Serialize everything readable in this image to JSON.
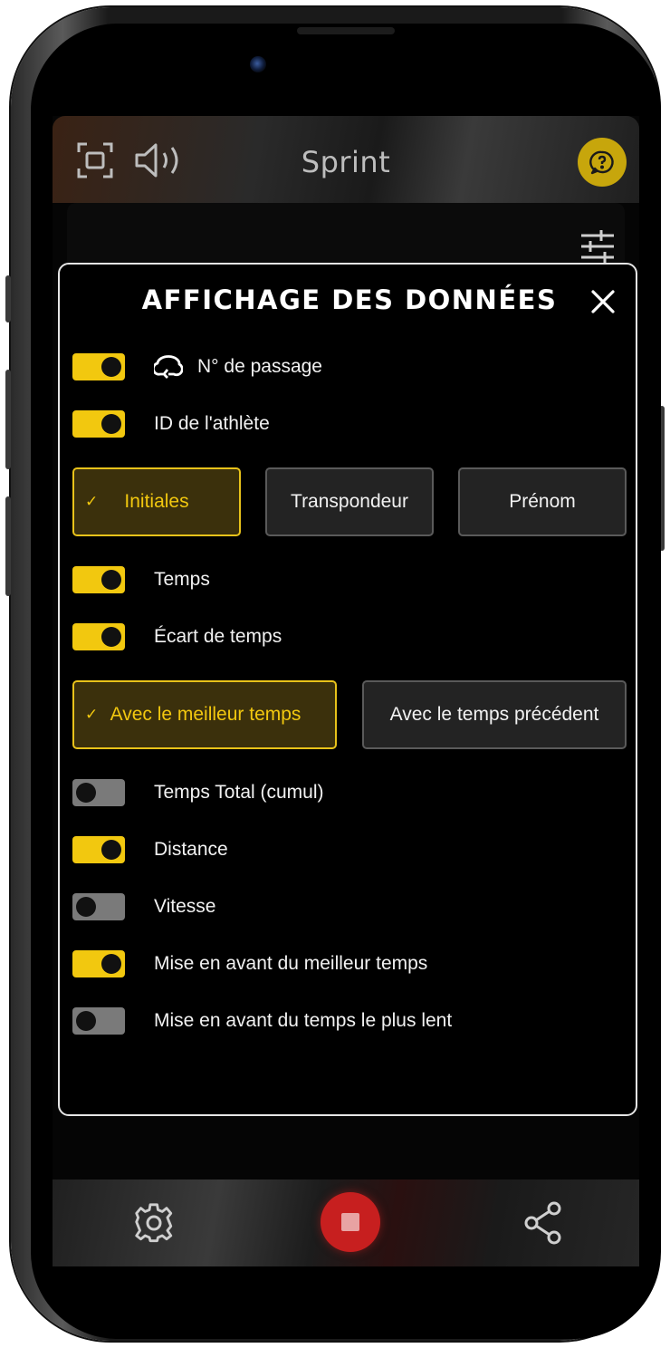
{
  "app": {
    "title": "Sprint"
  },
  "modal": {
    "title": "AFFICHAGE DES DONNÉES",
    "rows": [
      {
        "label": "N° de passage",
        "on": true
      },
      {
        "label": "ID de l'athlète",
        "on": true
      },
      {
        "label": "Temps",
        "on": true
      },
      {
        "label": "Écart de temps",
        "on": true
      },
      {
        "label": "Temps Total (cumul)",
        "on": false
      },
      {
        "label": "Distance",
        "on": true
      },
      {
        "label": "Vitesse",
        "on": false
      },
      {
        "label": "Mise en avant du meilleur temps",
        "on": true
      },
      {
        "label": "Mise en avant du temps le plus lent",
        "on": false
      }
    ],
    "athlete_id_options": [
      {
        "label": "Initiales",
        "selected": true
      },
      {
        "label": "Transpondeur",
        "selected": false
      },
      {
        "label": "Prénom",
        "selected": false
      }
    ],
    "gap_options": [
      {
        "label": "Avec le meilleur temps",
        "selected": true
      },
      {
        "label": "Avec le temps précédent",
        "selected": false
      }
    ],
    "check_glyph": "✓"
  },
  "icons": {
    "topbar": [
      "fullscreen-icon",
      "speaker-icon",
      "help-chat-icon"
    ],
    "card": [
      "filter-sliders-icon"
    ],
    "modal": [
      "close-icon",
      "loop-icon"
    ],
    "bottombar": [
      "settings-gear-icon",
      "stop-icon",
      "share-icon"
    ]
  },
  "colors": {
    "accent_yellow": "#f2c80f",
    "stop_red": "#c71f1f",
    "toggle_off": "#7a7a7a",
    "modal_border": "#e6e6e6"
  }
}
